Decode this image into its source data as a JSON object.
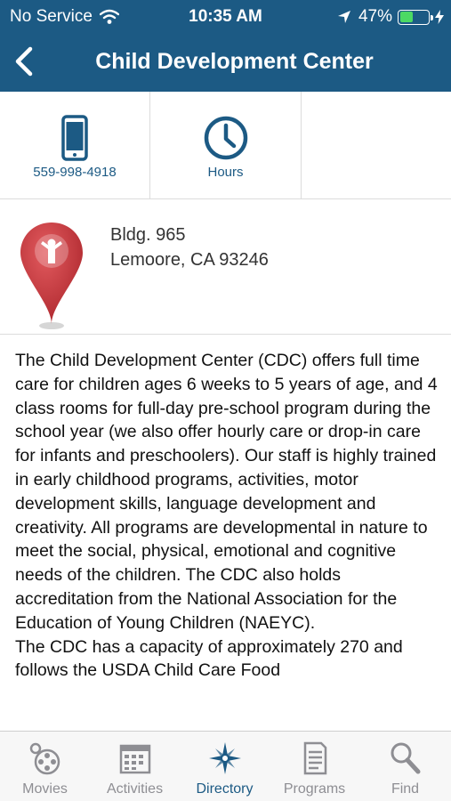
{
  "status_bar": {
    "carrier": "No Service",
    "time": "10:35 AM",
    "battery_percent": "47%",
    "battery_level": 0.47,
    "battery_color": "#4cd964"
  },
  "nav": {
    "title": "Child Development Center",
    "back_icon": "chevron-left-icon"
  },
  "actions": [
    {
      "label": "559-998-4918",
      "icon": "phone-icon"
    },
    {
      "label": "Hours",
      "icon": "clock-icon"
    }
  ],
  "address": {
    "line1": "Bldg. 965",
    "line2": "Lemoore, CA 93246",
    "icon": "map-pin-icon"
  },
  "description": {
    "paragraph1": "The Child Development Center (CDC) offers full time care for children ages 6 weeks to 5 years of age, and 4 class rooms for full-day pre-school program during the school year (we also offer hourly care or drop-in care for infants and preschoolers). Our staff is highly trained in early childhood programs, activities, motor development skills, language development and creativity. All programs are developmental in nature to meet the social, physical, emotional and cognitive needs of the children. The CDC also holds accreditation from the National Association for the Education of Young Children (NAEYC).",
    "paragraph2": "The CDC has a capacity of approximately 270 and follows the USDA Child Care Food"
  },
  "tabs": [
    {
      "label": "Movies",
      "icon": "film-reel-icon",
      "active": false
    },
    {
      "label": "Activities",
      "icon": "calendar-icon",
      "active": false
    },
    {
      "label": "Directory",
      "icon": "compass-icon",
      "active": true
    },
    {
      "label": "Programs",
      "icon": "document-icon",
      "active": false
    },
    {
      "label": "Find",
      "icon": "search-icon",
      "active": false
    }
  ],
  "colors": {
    "brand": "#1c5a84",
    "pin": "#c8363b",
    "tab_inactive": "#8e8e93"
  }
}
